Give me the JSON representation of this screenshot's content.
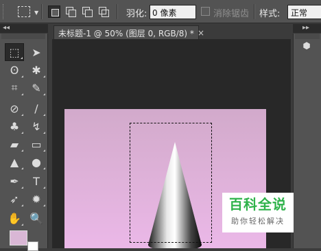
{
  "options_bar": {
    "feather_label": "羽化:",
    "feather_value": "0 像素",
    "antialias_label": "消除锯齿",
    "style_label": "样式:",
    "style_value": "正常"
  },
  "document_tab": {
    "title": "未标题-1 @ 50% (图层 0, RGB/8) *",
    "close": "×"
  },
  "panel_collapse": {
    "left": "◂◂",
    "right": "▸▸"
  },
  "tools": [
    {
      "name": "rectangular-marquee-tool",
      "glyph": "⬚"
    },
    {
      "name": "move-tool",
      "glyph": "➤"
    },
    {
      "name": "lasso-tool",
      "glyph": "ʘ"
    },
    {
      "name": "magic-wand-tool",
      "glyph": "✱"
    },
    {
      "name": "crop-tool",
      "glyph": "⌗"
    },
    {
      "name": "eyedropper-tool",
      "glyph": "✎"
    },
    {
      "name": "spot-healing-tool",
      "glyph": "⊘"
    },
    {
      "name": "brush-tool",
      "glyph": "∕"
    },
    {
      "name": "clone-stamp-tool",
      "glyph": "♣"
    },
    {
      "name": "history-brush-tool",
      "glyph": "↯"
    },
    {
      "name": "eraser-tool",
      "glyph": "▰"
    },
    {
      "name": "gradient-tool",
      "glyph": "▭"
    },
    {
      "name": "blur-tool",
      "glyph": "▲"
    },
    {
      "name": "dodge-tool",
      "glyph": "●"
    },
    {
      "name": "pen-tool",
      "glyph": "✒"
    },
    {
      "name": "type-tool",
      "glyph": "T"
    },
    {
      "name": "path-selection-tool",
      "glyph": "➶"
    },
    {
      "name": "custom-shape-tool",
      "glyph": "✹"
    },
    {
      "name": "hand-tool",
      "glyph": "✋"
    },
    {
      "name": "zoom-tool",
      "glyph": "🔍"
    }
  ],
  "colors": {
    "foreground": "#d9b7d5",
    "background": "#ffffff",
    "canvas_top": "#d2aacb",
    "canvas_bottom": "#ebb8e8"
  },
  "watermark": {
    "title": "百科全说",
    "subtitle": "助你轻松解决"
  }
}
